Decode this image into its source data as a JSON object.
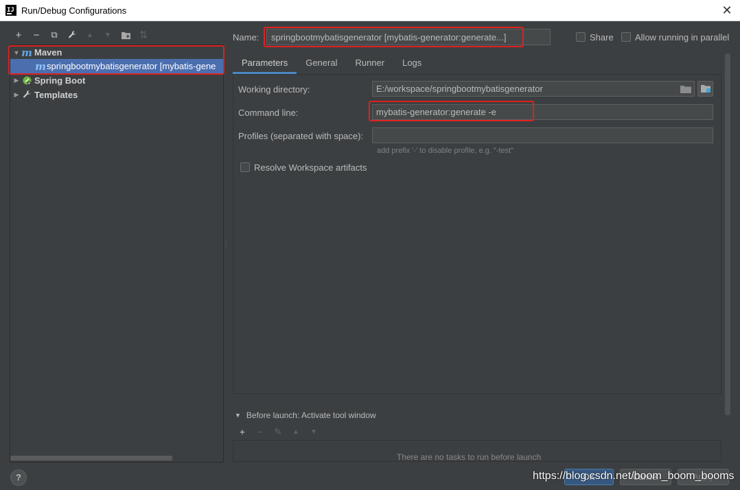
{
  "window": {
    "title": "Run/Debug Configurations",
    "close_glyph": "✕",
    "app_icon_text": "IJ"
  },
  "left_toolbar": {
    "items": [
      {
        "icon": "plus-icon",
        "glyph": "+"
      },
      {
        "icon": "minus-icon",
        "glyph": "−"
      },
      {
        "icon": "copy-icon",
        "glyph": "⧉"
      },
      {
        "icon": "wrench-icon",
        "glyph": "🔧"
      },
      {
        "icon": "move-up-icon",
        "glyph": "▲"
      },
      {
        "icon": "move-down-icon",
        "glyph": "▼"
      },
      {
        "icon": "new-folder-icon",
        "glyph": "▣"
      },
      {
        "icon": "sort-icon",
        "glyph": "⇅"
      }
    ]
  },
  "tree": {
    "maven": {
      "arrow": "▼",
      "label": "Maven",
      "icon": "maven-icon"
    },
    "config": {
      "label": "springbootmybatisgenerator [mybatis-gene",
      "icon": "maven-icon"
    },
    "spring_boot": {
      "arrow": "▶",
      "label": "Spring Boot",
      "icon": "spring-boot-icon"
    },
    "templates": {
      "arrow": "▶",
      "label": "Templates",
      "icon": "wrench-icon"
    }
  },
  "header": {
    "name_label": "Name:",
    "name_value": "springbootmybatisgenerator [mybatis-generator:generate...]",
    "share_label": "Share",
    "parallel_label": "Allow running in parallel"
  },
  "tabs": [
    {
      "label": "Parameters",
      "active": true
    },
    {
      "label": "General",
      "active": false
    },
    {
      "label": "Runner",
      "active": false
    },
    {
      "label": "Logs",
      "active": false
    }
  ],
  "parameters": {
    "working_dir_label": "Working directory:",
    "working_dir_value": "E:/workspace/springbootmybatisgenerator",
    "command_line_label": "Command line:",
    "command_line_value": "mybatis-generator:generate -e",
    "profiles_label": "Profiles (separated with space):",
    "profiles_value": "",
    "profiles_hint": "add prefix '-' to disable profile, e.g. \"-test\"",
    "resolve_label": "Resolve Workspace artifacts"
  },
  "before_launch": {
    "title": "Before launch: Activate tool window",
    "empty_text": "There are no tasks to run before launch",
    "toolbar": [
      {
        "icon": "plus-icon",
        "glyph": "+"
      },
      {
        "icon": "minus-icon",
        "glyph": "−"
      },
      {
        "icon": "edit-icon",
        "glyph": "✎"
      },
      {
        "icon": "move-up-icon",
        "glyph": "▲"
      },
      {
        "icon": "move-down-icon",
        "glyph": "▼"
      }
    ]
  },
  "footer": {
    "help_label": "?",
    "ok_label": "OK",
    "cancel_label": "Cancel",
    "apply_label": "Apply"
  },
  "watermark": "https://blog.csdn.net/boom_boom_booms",
  "colors": {
    "background": "#3c3f41",
    "selection": "#4b6eaf",
    "highlight": "#e02020",
    "accent": "#4a88c7",
    "maven": "#62a8e5",
    "spring": "#6db33f"
  }
}
